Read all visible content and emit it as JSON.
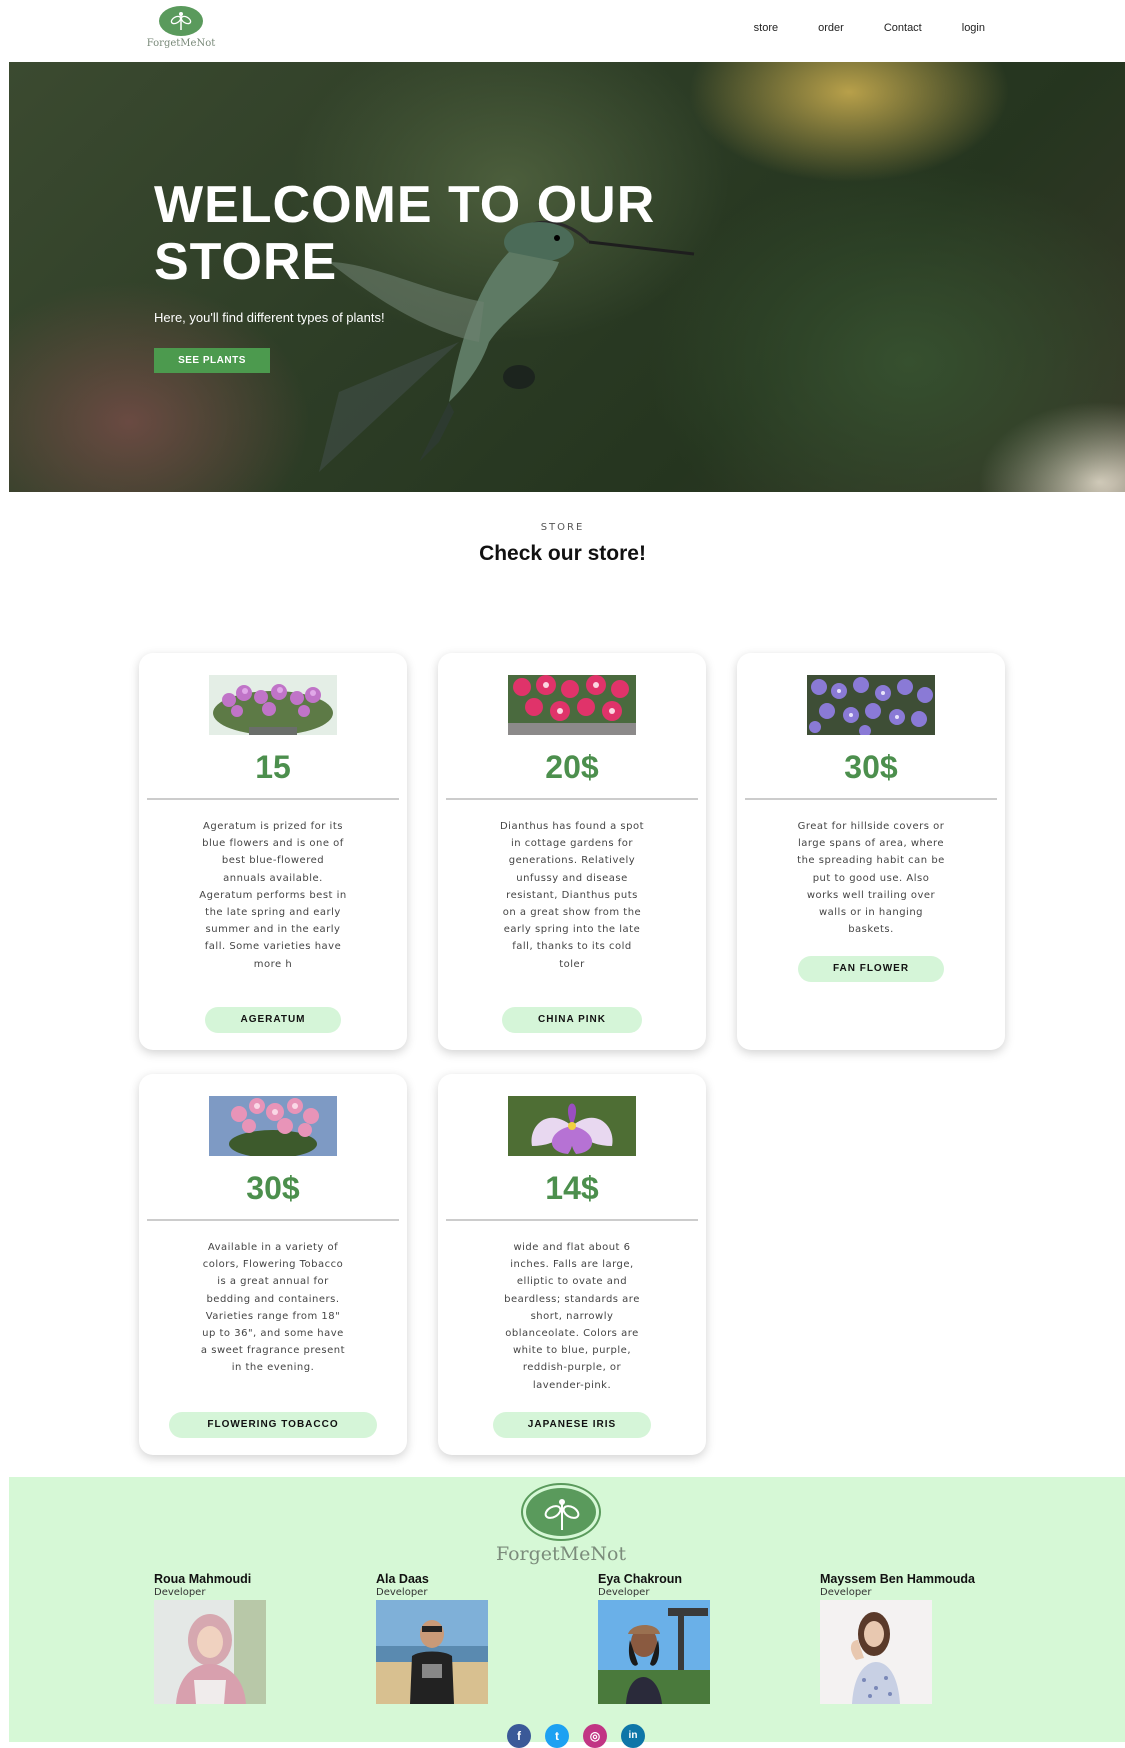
{
  "nav": {
    "logo_text": "ForgetMeNot",
    "links": [
      "store",
      "order",
      "Contact",
      "login"
    ]
  },
  "hero": {
    "title": "WELCOME TO OUR STORE",
    "subtitle": "Here, you'll find different types of plants!",
    "cta": "SEE PLANTS"
  },
  "store": {
    "tag": "STORE",
    "title": "Check our store!"
  },
  "cards": [
    {
      "price": "15",
      "desc": "Ageratum is prized for its blue flowers and is one of best blue-flowered annuals available. Ageratum performs best in the late spring and early summer and in the early fall. Some varieties have more h",
      "name": "AGERATUM"
    },
    {
      "price": "20$",
      "desc": "Dianthus has found a spot in cottage gardens for generations. Relatively unfussy and disease resistant, Dianthus puts on a great show from the early spring into the late fall, thanks to its cold toler",
      "name": "CHINA PINK"
    },
    {
      "price": "30$",
      "desc": "Great for hillside covers or large spans of area, where the spreading habit can be put to good use. Also works well trailing over walls or in hanging baskets.",
      "name": "FAN FLOWER"
    },
    {
      "price": "30$",
      "desc": "Available in a variety of colors, Flowering Tobacco is a great annual for bedding and containers. Varieties range from 18\" up to 36\", and some have a sweet fragrance present in the evening.",
      "name": "FLOWERING TOBACCO"
    },
    {
      "price": "14$",
      "desc": "wide and flat about 6 inches. Falls are large, elliptic to ovate and beardless; standards are short, narrowly oblanceolate. Colors are white to blue, purple, reddish-purple, or lavender-pink.",
      "name": "JAPANESE IRIS"
    }
  ],
  "footer": {
    "logo_text": "ForgetMeNot",
    "developers": [
      {
        "name": "Roua Mahmoudi",
        "role": "Developer"
      },
      {
        "name": "Ala Daas",
        "role": "Developer"
      },
      {
        "name": "Eya Chakroun",
        "role": "Developer"
      },
      {
        "name": "Mayssem Ben Hammouda",
        "role": "Developer"
      }
    ],
    "social": [
      {
        "icon": "facebook-icon",
        "glyph": "f",
        "color": "#3b5998"
      },
      {
        "icon": "twitter-icon",
        "glyph": "t",
        "color": "#1da1f2"
      },
      {
        "icon": "instagram-icon",
        "glyph": "◎",
        "color": "#c13584"
      },
      {
        "icon": "linkedin-icon",
        "glyph": "in",
        "color": "#0e76a8"
      }
    ]
  },
  "colors": {
    "accent": "#4c9a4e",
    "price": "#4c8f4d",
    "tag_bg": "#d5f5d8",
    "footer_bg": "#d6f8d6"
  }
}
